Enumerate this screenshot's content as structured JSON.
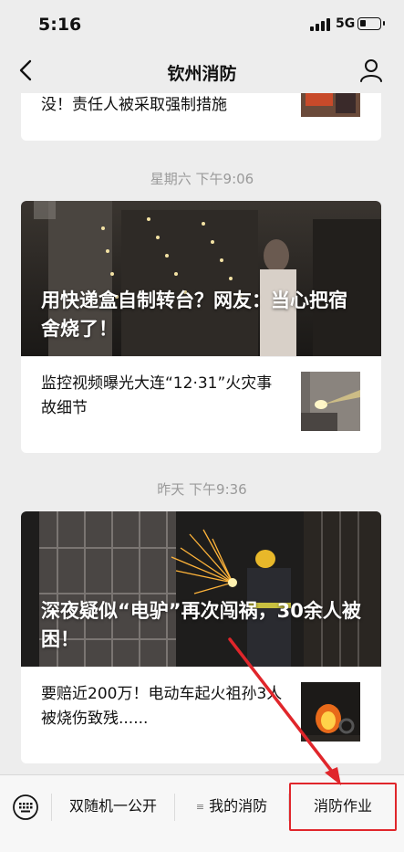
{
  "status": {
    "time": "5:16",
    "network": "5G"
  },
  "header": {
    "title": "钦州消防"
  },
  "feed": {
    "top_item": {
      "text": "没！责任人被采取强制措施"
    },
    "groups": [
      {
        "timestamp": "星期六 下午9:06",
        "hero_title": "用快递盒自制转台？网友：当心把宿舍烧了！",
        "item": {
          "text": "监控视频曝光大连“12·31”火灾事故细节"
        }
      },
      {
        "timestamp": "昨天 下午9:36",
        "hero_title": "深夜疑似“电驴”再次闯祸，30余人被困！",
        "item": {
          "text": "要赔近200万！电动车起火祖孙3人被烧伤致残......"
        }
      }
    ]
  },
  "menu": {
    "items": [
      {
        "label": "双随机一公开"
      },
      {
        "label": "我的消防",
        "has_submenu": true
      },
      {
        "label": "消防作业"
      }
    ]
  },
  "annotation": {
    "color": "#e0262b",
    "target": "消防作业"
  }
}
